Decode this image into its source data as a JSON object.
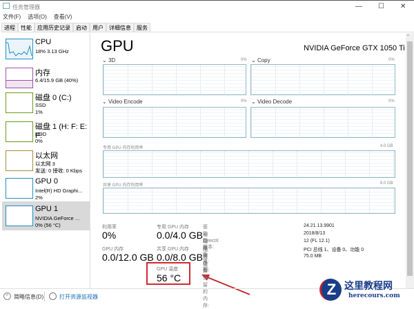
{
  "window": {
    "title": "任务管理器",
    "minimize": "—",
    "maximize": "☐",
    "close": "✕"
  },
  "menu": [
    "文件(F)",
    "选项(O)",
    "查看(V)"
  ],
  "tabs": [
    "进程",
    "性能",
    "应用历史记录",
    "启动",
    "用户",
    "详细信息",
    "服务"
  ],
  "sidebar": [
    {
      "name": "CPU",
      "d1": "18% 3.13 GHz",
      "d2": "",
      "color": "#1e8fc4"
    },
    {
      "name": "内存",
      "d1": "6.4/15.9 GB (40%)",
      "d2": "",
      "color": "#9b4fa8"
    },
    {
      "name": "磁盘 0 (C:)",
      "d1": "SSD",
      "d2": "1%",
      "color": "#6c9b1a"
    },
    {
      "name": "磁盘 1 (H: F: E: F:",
      "d1": "HDD",
      "d2": "0%",
      "color": "#6c9b1a"
    },
    {
      "name": "以太网",
      "d1": "以太网 3",
      "d2": "发送: 0 接收: 0 Kbps",
      "color": "#a88a3a"
    },
    {
      "name": "GPU 0",
      "d1": "Intel(R) HD Graphi...",
      "d2": "2%",
      "color": "#1e8fc4"
    },
    {
      "name": "GPU 1",
      "d1": "NVIDIA GeForce ...",
      "d2": "0% (56 °C)",
      "color": "#1e8fc4"
    }
  ],
  "main": {
    "title": "GPU",
    "gpu_name": "NVIDIA GeForce GTX 1050 Ti",
    "engines": [
      {
        "label": "3D",
        "pct": "0%"
      },
      {
        "label": "Copy",
        "pct": "0%"
      },
      {
        "label": "Video Encode",
        "pct": "0%"
      },
      {
        "label": "Video Decode",
        "pct": "0%"
      }
    ],
    "dedicated": {
      "label": "专用 GPU 内存利用率",
      "max": "4.0 GB"
    },
    "shared": {
      "label": "共享 GPU 内存利用率",
      "max": "8.0 GB"
    },
    "stats": {
      "util_label": "利用率",
      "util": "0%",
      "gpumem_label": "GPU 内存",
      "gpumem": "0.0/12.0 GB",
      "ded_label": "专用 GPU 内存",
      "ded": "0.0/4.0 GB",
      "shr_label": "共享 GPU 内存",
      "shr": "0.0/8.0 GB",
      "temp_label": "GPU 温度",
      "temp": "56 °C"
    },
    "info": [
      {
        "k": "驱动程序版本:",
        "v": "24.21.13.9901"
      },
      {
        "k": "驱动程序日期:",
        "v": "2018/8/13"
      },
      {
        "k": "DirectX 版本:",
        "v": "12 (FL 12.1)"
      },
      {
        "k": "物理位置:",
        "v": "PCI 总线 1、设备 0、功能 0"
      },
      {
        "k": "为硬件保留的内存:",
        "v": "75.0 MB"
      }
    ]
  },
  "footer": {
    "brief": "简略信息(D)",
    "monitor": "打开资源监视器"
  },
  "watermark": {
    "name": "这里教程网",
    "url": "herecours.com"
  },
  "colors": {
    "highlight": "#d0282e"
  }
}
